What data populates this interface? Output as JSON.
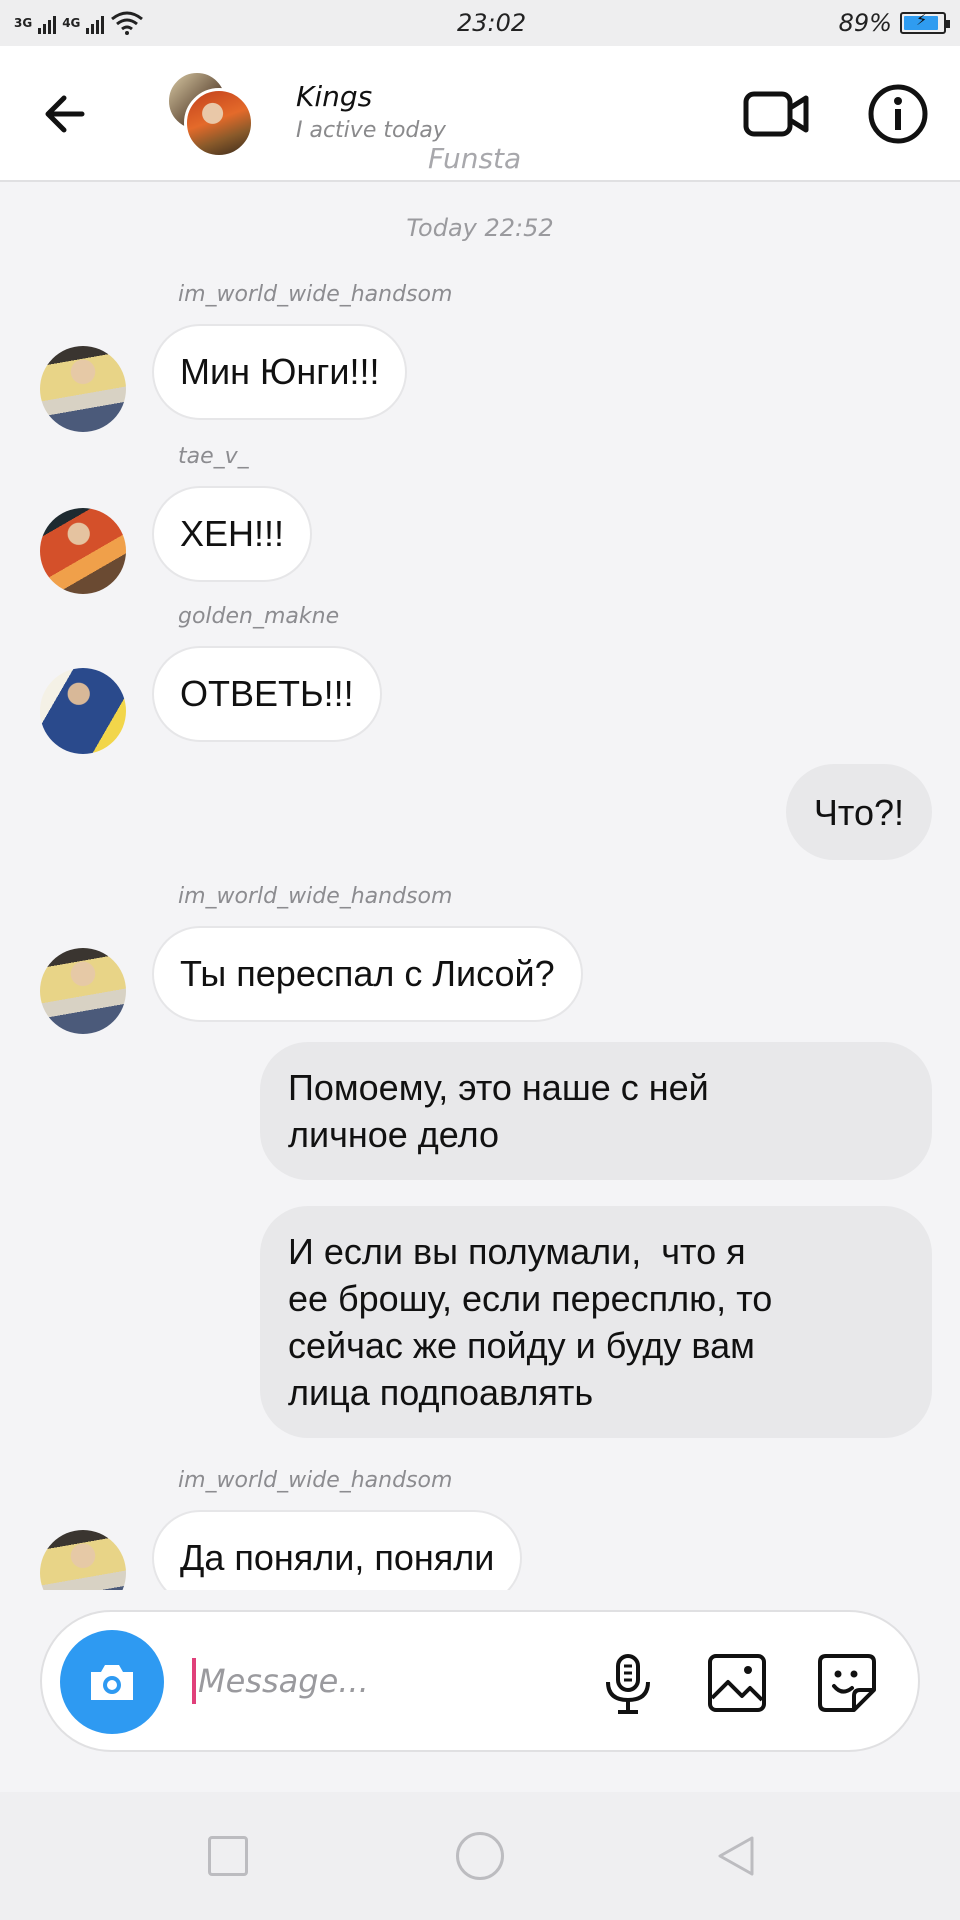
{
  "status_bar": {
    "network_1": "3G",
    "network_2": "4G",
    "time": "23:02",
    "battery": "89%",
    "battery_level": 0.89
  },
  "header": {
    "title": "Kings",
    "status": "I active today",
    "subtitle": "Funsta"
  },
  "conversation": {
    "timestamp": "Today 22:52",
    "messages": [
      {
        "sender": "im_world_wide_handsom",
        "text": "Мин Юнги!!!"
      },
      {
        "sender": "tae_v_",
        "text": "ХЕН!!!"
      },
      {
        "sender": "golden_makne",
        "text": "ОТВЕТЬ!!!"
      },
      {
        "text": "Что?!"
      },
      {
        "sender": "im_world_wide_handsom",
        "text": "Ты переспал с Лисой?"
      },
      {
        "text_lines": [
          "Помоему, это наше с ней",
          "личное дело"
        ]
      },
      {
        "text_lines": [
          "И если вы полумали,  что я",
          "ее брошу, если пересплю, то",
          "сейчас же пойду и буду вам",
          "лица подпоавлять"
        ]
      },
      {
        "sender": "im_world_wide_handsom",
        "text": "Да поняли, поняли"
      }
    ]
  },
  "composer": {
    "placeholder": "Message..."
  },
  "icons": {
    "back": "arrow-left-icon",
    "video": "video-camera-icon",
    "info": "info-icon",
    "camera": "camera-icon",
    "mic": "microphone-icon",
    "gallery": "image-icon",
    "sticker": "sticker-icon"
  },
  "colors": {
    "accent": "#2e9af2",
    "bubble_out": "#e8e8ea",
    "cursor": "#e0407a"
  }
}
